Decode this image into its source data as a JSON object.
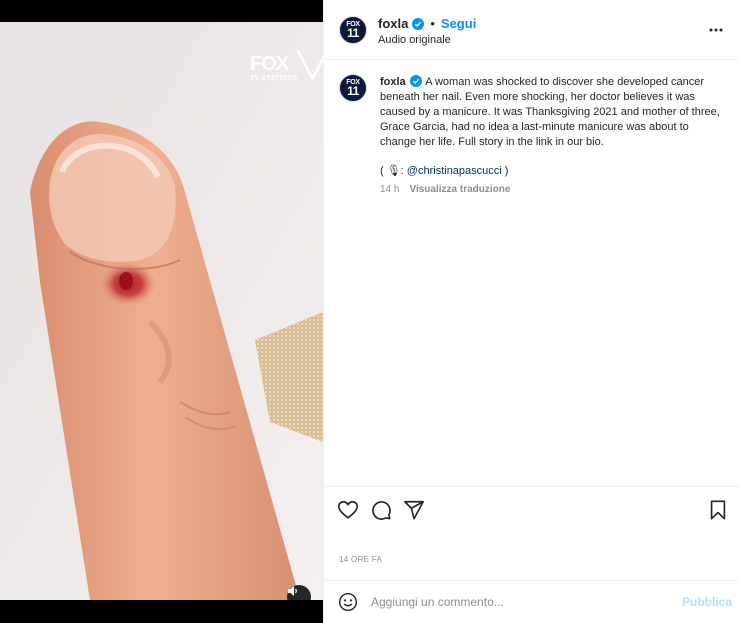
{
  "media": {
    "watermark_line1": "FOX",
    "watermark_line2": "TV STATIONS",
    "audio_icon": "volume-icon"
  },
  "avatar": {
    "line1": "FOX",
    "line2": "11"
  },
  "header": {
    "username": "foxla",
    "separator": "•",
    "follow_label": "Segui",
    "subtitle": "Audio originale"
  },
  "caption": {
    "username": "foxla",
    "text": "A woman was shocked to discover she developed cancer beneath her nail. Even more shocking, her doctor believes it was caused by a manicure. It was Thanksgiving 2021 and mother of three, Grace Garcia, had no idea a last-minute manicure was about to change her life. Full story in the link in our bio.",
    "credit_prefix": "( 🎙: ",
    "credit_mention": "@christinapascucci",
    "credit_suffix": " )",
    "time": "14 h",
    "translate_label": "Visualizza traduzione"
  },
  "footer": {
    "date": "14 ORE FA",
    "comment_placeholder": "Aggiungi un commento...",
    "publish_label": "Pubblica"
  },
  "colors": {
    "accent": "#0095f6",
    "publish_disabled": "#b2dffc",
    "avatar_bg": "#0a1a3d"
  }
}
